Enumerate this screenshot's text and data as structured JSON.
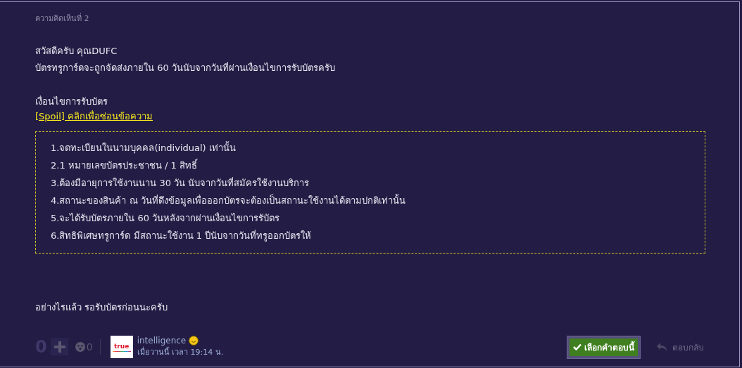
{
  "comment_label": "ความคิดเห็นที่ 2",
  "body": [
    "สวัสดีครับ คุณDUFC",
    "บัตรทรูการ์ดจะถูกจัดส่งภายใน 60 วันนับจากวันที่ผ่านเงื่อนไขการรับบัตรครับ"
  ],
  "conditions_heading": "เงื่อนไขการรับบัตร",
  "spoiler_link": "[Spoil] คลิกเพื่อซ่อนข้อความ",
  "spoiler_items": [
    "1.จดทะเบียนในนามบุคคล(individual) เท่านั้น",
    "2.1 หมายเลขบัตรประชาชน / 1 สิทธิ์",
    "3.ต้องมีอายุการใช้งานนาน 30 วัน นับจากวันที่สมัครใช้งานบริการ",
    "4.สถานะของสินค้า ณ วันที่ดึงข้อมูลเพื่อออกบัตรจะต้องเป็นสถานะใช้งานได้ตามปกติเท่านั้น",
    "5.จะได้รับบัตรภายใน 60 วันหลังจากผ่านเงื่อนไขการรับัตร",
    "6.สิทธิพิเศษทรูการ์ด มีสถานะใช้งาน 1 ปีนับจากวันที่ทรูออกบัตรให้"
  ],
  "closing": "อย่างไรแล้ว รอรับบัตรก่อนนะครับ",
  "footer": {
    "votes": "0",
    "emotions": "0",
    "avatar_text": "true",
    "author": "intelligence",
    "time": "เมื่อวานนี้ เวลา 19:14 น.",
    "select_button": "เลือกคำตอบนี้",
    "reply": "ตอบกลับ"
  }
}
